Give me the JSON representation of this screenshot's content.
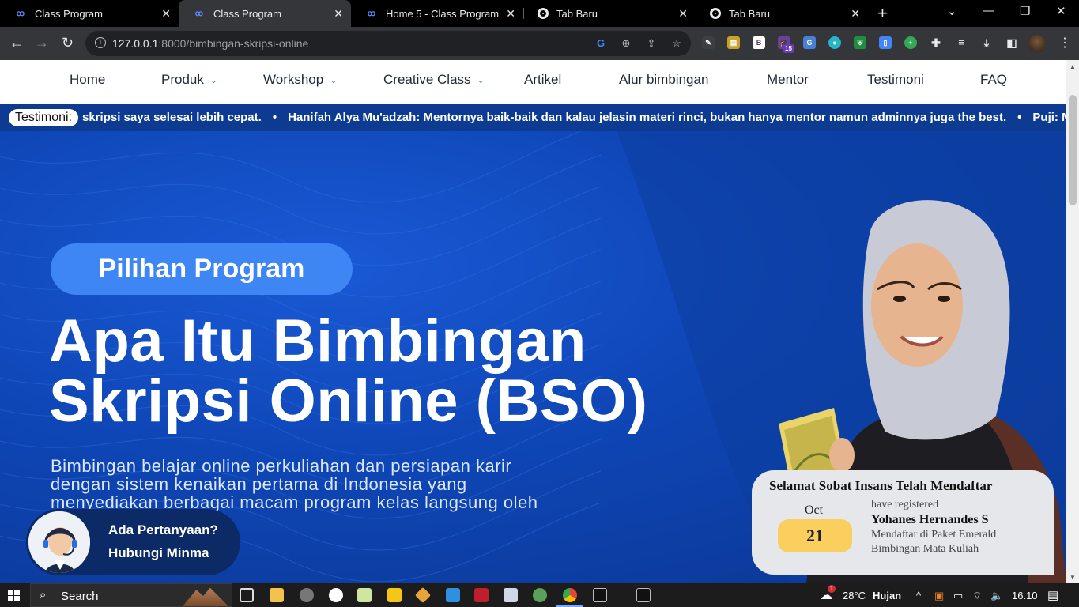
{
  "browser": {
    "tabs": [
      {
        "title": "Class Program",
        "favicon": "cp-icon"
      },
      {
        "title": "Class Program",
        "favicon": "cp-icon"
      },
      {
        "title": "Home 5 - Class Program",
        "favicon": "cp-icon"
      },
      {
        "title": "Tab Baru",
        "favicon": "chrome-icon"
      },
      {
        "title": "Tab Baru",
        "favicon": "chrome-icon"
      }
    ],
    "url_host": "127.0.0.1",
    "url_rest": ":8000/bimbingan-skripsi-online",
    "extension_badge": "15"
  },
  "site": {
    "nav": [
      {
        "label": "Home",
        "dropdown": false
      },
      {
        "label": "Produk",
        "dropdown": true
      },
      {
        "label": "Workshop",
        "dropdown": true
      },
      {
        "label": "Creative Class",
        "dropdown": true
      },
      {
        "label": "Artikel",
        "dropdown": false
      },
      {
        "label": "Alur bimbingan",
        "dropdown": false
      },
      {
        "label": "Mentor",
        "dropdown": false
      },
      {
        "label": "Testimoni",
        "dropdown": false
      },
      {
        "label": "FAQ",
        "dropdown": false
      }
    ],
    "marquee": {
      "label": "Testimoni:",
      "items": [
        "skripsi saya selesai lebih cepat.",
        "Hanifah Alya Mu'adzah: Mentornya baik-baik dan kalau jelasin materi rinci, bukan hanya mentor namun adminnya juga the best.",
        "Puji: M"
      ]
    },
    "hero": {
      "pill": "Pilihan Program",
      "title_line1": "Apa Itu Bimbingan",
      "title_line2": "Skripsi Online (BSO)",
      "description": "Bimbingan belajar online perkuliahan dan persiapan karir dengan sistem kenaikan pertama di Indonesia yang menyediakan berbagai macam program kelas langsung oleh Mentor yang ahli di"
    },
    "chat": {
      "line1": "Ada Pertanyaan?",
      "line2": "Hubungi Minma"
    },
    "toast": {
      "heading": "Selamat Sobat Insans Telah Mendaftar",
      "month": "Oct",
      "day": "21",
      "line1": "have registered",
      "name": "Yohanes Hernandes S",
      "line3": "Mendaftar di Paket Emerald",
      "line4": "Bimbingan Mata Kuliah"
    }
  },
  "taskbar": {
    "search_placeholder": "Search",
    "weather": "28°C",
    "weather_text": "Hujan",
    "weather_badge": "1",
    "time": "16.10"
  }
}
